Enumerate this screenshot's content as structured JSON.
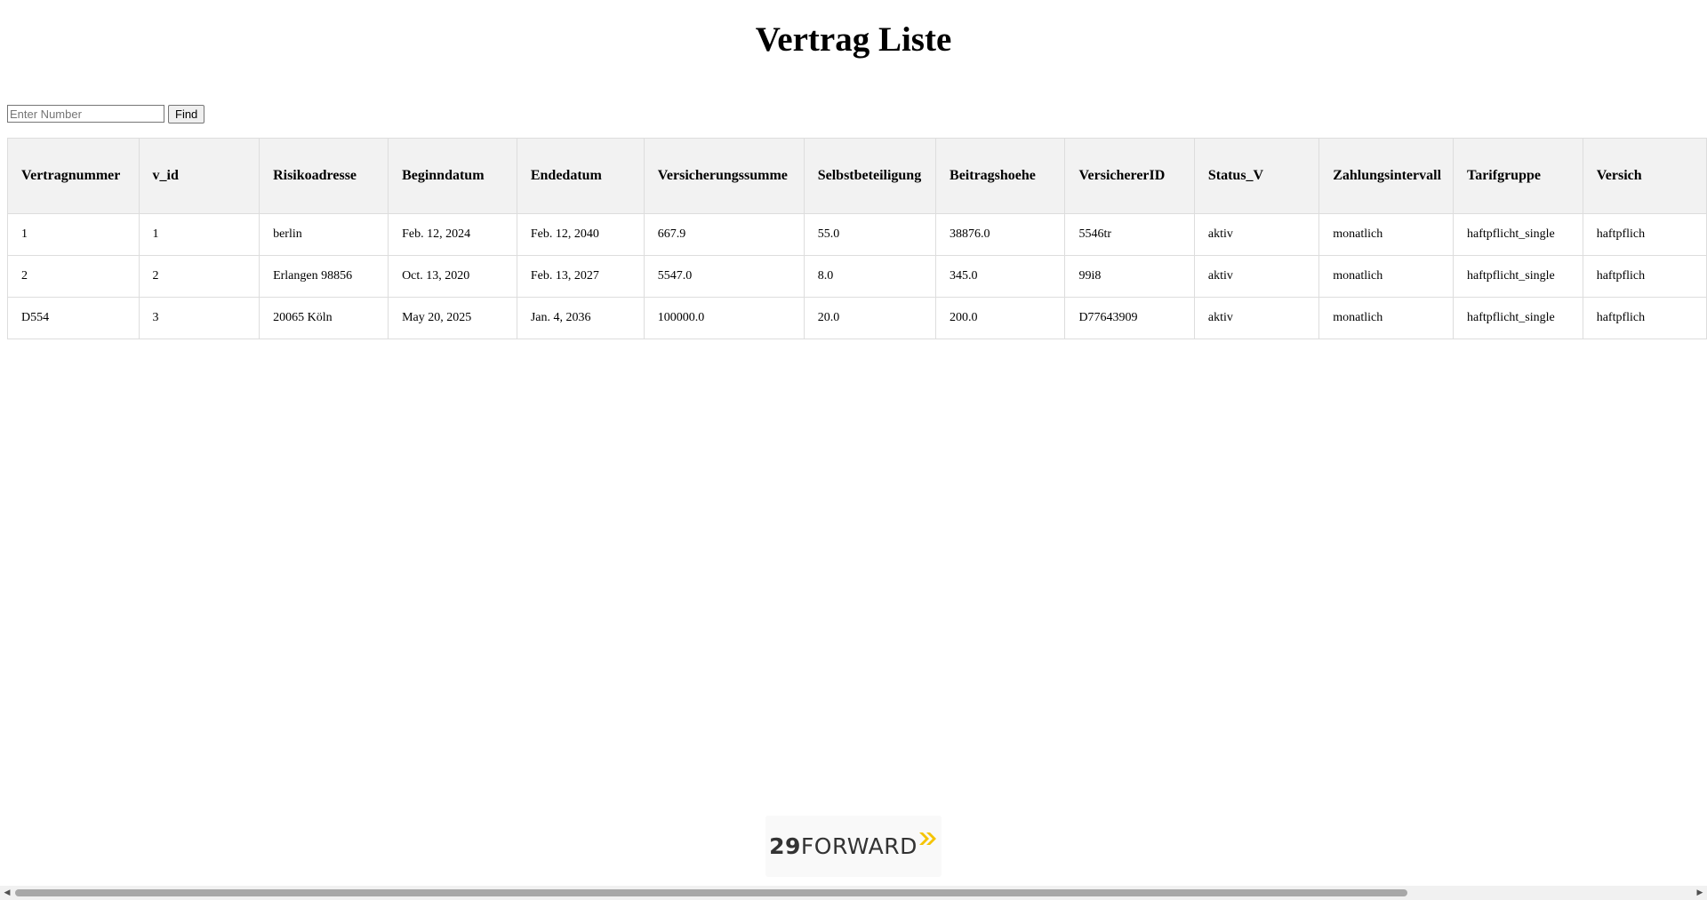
{
  "page": {
    "title": "Vertrag Liste"
  },
  "search": {
    "placeholder": "Enter Number",
    "value": "",
    "button_label": "Find"
  },
  "table": {
    "columns": [
      "Vertragnummer",
      "v_id",
      "Risikoadresse",
      "Beginndatum",
      "Endedatum",
      "Versicherungssumme",
      "Selbstbeteiligung",
      "Beitragshoehe",
      "VersichererID",
      "Status_V",
      "Zahlungsintervall",
      "Tarifgruppe",
      "Versich"
    ],
    "rows": [
      [
        "1",
        "1",
        "berlin",
        "Feb. 12, 2024",
        "Feb. 12, 2040",
        "667.9",
        "55.0",
        "38876.0",
        "5546tr",
        "aktiv",
        "monatlich",
        "haftpflicht_single",
        "haftpflich"
      ],
      [
        "2",
        "2",
        "Erlangen 98856",
        "Oct. 13, 2020",
        "Feb. 13, 2027",
        "5547.0",
        "8.0",
        "345.0",
        "99i8",
        "aktiv",
        "monatlich",
        "haftpflicht_single",
        "haftpflich"
      ],
      [
        "D554",
        "3",
        "20065 Köln",
        "May 20, 2025",
        "Jan. 4, 2036",
        "100000.0",
        "20.0",
        "200.0",
        "D77643909",
        "aktiv",
        "monatlich",
        "haftpflicht_single",
        "haftpflich"
      ]
    ]
  },
  "footer": {
    "logo_number": "29",
    "logo_word": "FORWARD",
    "logo_accent_color": "#f5c400"
  },
  "scrollbar": {
    "left_arrow_icon": "arrow-left-icon",
    "right_arrow_icon": "arrow-right-icon"
  }
}
